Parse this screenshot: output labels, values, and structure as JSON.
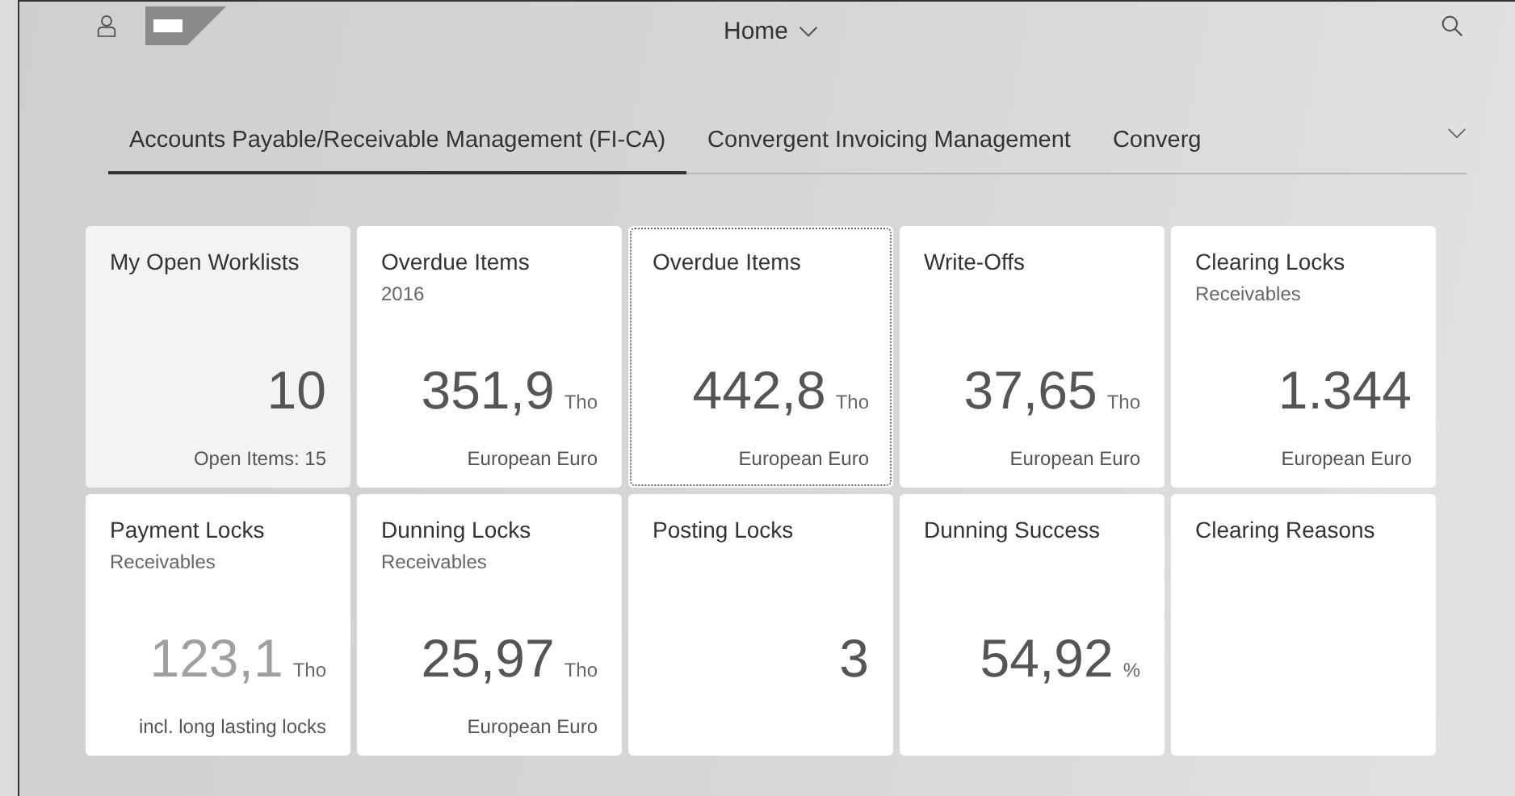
{
  "header": {
    "title": "Home"
  },
  "tabs": [
    {
      "label": "Accounts Payable/Receivable Management (FI-CA)",
      "selected": true
    },
    {
      "label": "Convergent Invoicing Management",
      "selected": false
    },
    {
      "label": "Converg",
      "selected": false
    }
  ],
  "tiles": [
    {
      "kind": "numeric",
      "title": "My Open Worklists",
      "value": "10",
      "footer": "Open Items: 15",
      "hovered": true,
      "focused": false,
      "muted": false
    },
    {
      "kind": "numeric",
      "title": "Overdue Items",
      "subtitle": "2016",
      "value": "351,9",
      "unit": "Tho",
      "footer": "European Euro",
      "hovered": false,
      "focused": false,
      "muted": false
    },
    {
      "kind": "numeric",
      "title": "Overdue Items",
      "value": "442,8",
      "unit": "Tho",
      "footer": "European Euro",
      "hovered": false,
      "focused": true,
      "muted": false
    },
    {
      "kind": "numeric",
      "title": "Write-Offs",
      "value": "37,65",
      "unit": "Tho",
      "footer": "European Euro",
      "hovered": false,
      "focused": false,
      "muted": false
    },
    {
      "kind": "numeric",
      "title": "Clearing Locks",
      "subtitle": "Receivables",
      "value": "1.344",
      "footer": "European Euro",
      "hovered": false,
      "focused": false,
      "muted": false
    },
    {
      "kind": "numeric",
      "title": "Payment Locks",
      "subtitle": "Receivables",
      "value": "123,1",
      "unit": "Tho",
      "footer": "incl. long lasting locks",
      "hovered": false,
      "focused": false,
      "muted": true
    },
    {
      "kind": "numeric",
      "title": "Dunning Locks",
      "subtitle": "Receivables",
      "value": "25,97",
      "unit": "Tho",
      "footer": "European Euro",
      "hovered": false,
      "focused": false,
      "muted": false
    },
    {
      "kind": "numeric",
      "title": "Posting Locks",
      "value": "3",
      "hovered": false,
      "focused": false,
      "muted": false
    },
    {
      "kind": "numeric",
      "title": "Dunning Success",
      "value": "54,92",
      "unit": "%",
      "hovered": false,
      "focused": false,
      "muted": false
    },
    {
      "kind": "launch",
      "title": "Clearing Reasons",
      "hovered": false,
      "focused": false
    }
  ]
}
